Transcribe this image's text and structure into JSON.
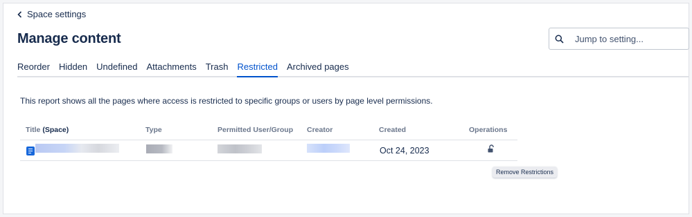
{
  "nav": {
    "back_label": "Space settings"
  },
  "page": {
    "title": "Manage content"
  },
  "search": {
    "placeholder": "Jump to setting..."
  },
  "tabs": [
    {
      "label": "Reorder",
      "active": false
    },
    {
      "label": "Hidden",
      "active": false
    },
    {
      "label": "Undefined",
      "active": false
    },
    {
      "label": "Attachments",
      "active": false
    },
    {
      "label": "Trash",
      "active": false
    },
    {
      "label": "Restricted",
      "active": true
    },
    {
      "label": "Archived pages",
      "active": false
    }
  ],
  "report": {
    "description": "This report shows all the pages where access is restricted to specific groups or users by page level permissions."
  },
  "table": {
    "headers": {
      "title": "Title",
      "title_suffix": "(Space)",
      "type": "Type",
      "permitted": "Permitted User/Group",
      "creator": "Creator",
      "created": "Created",
      "operations": "Operations"
    },
    "rows": [
      {
        "created": "Oct 24, 2023"
      }
    ]
  },
  "tooltip": {
    "text": "Remove Restrictions"
  },
  "colors": {
    "accent": "#0052cc",
    "text": "#172b4d",
    "muted": "#6b778c",
    "border": "#dfe1e6"
  }
}
